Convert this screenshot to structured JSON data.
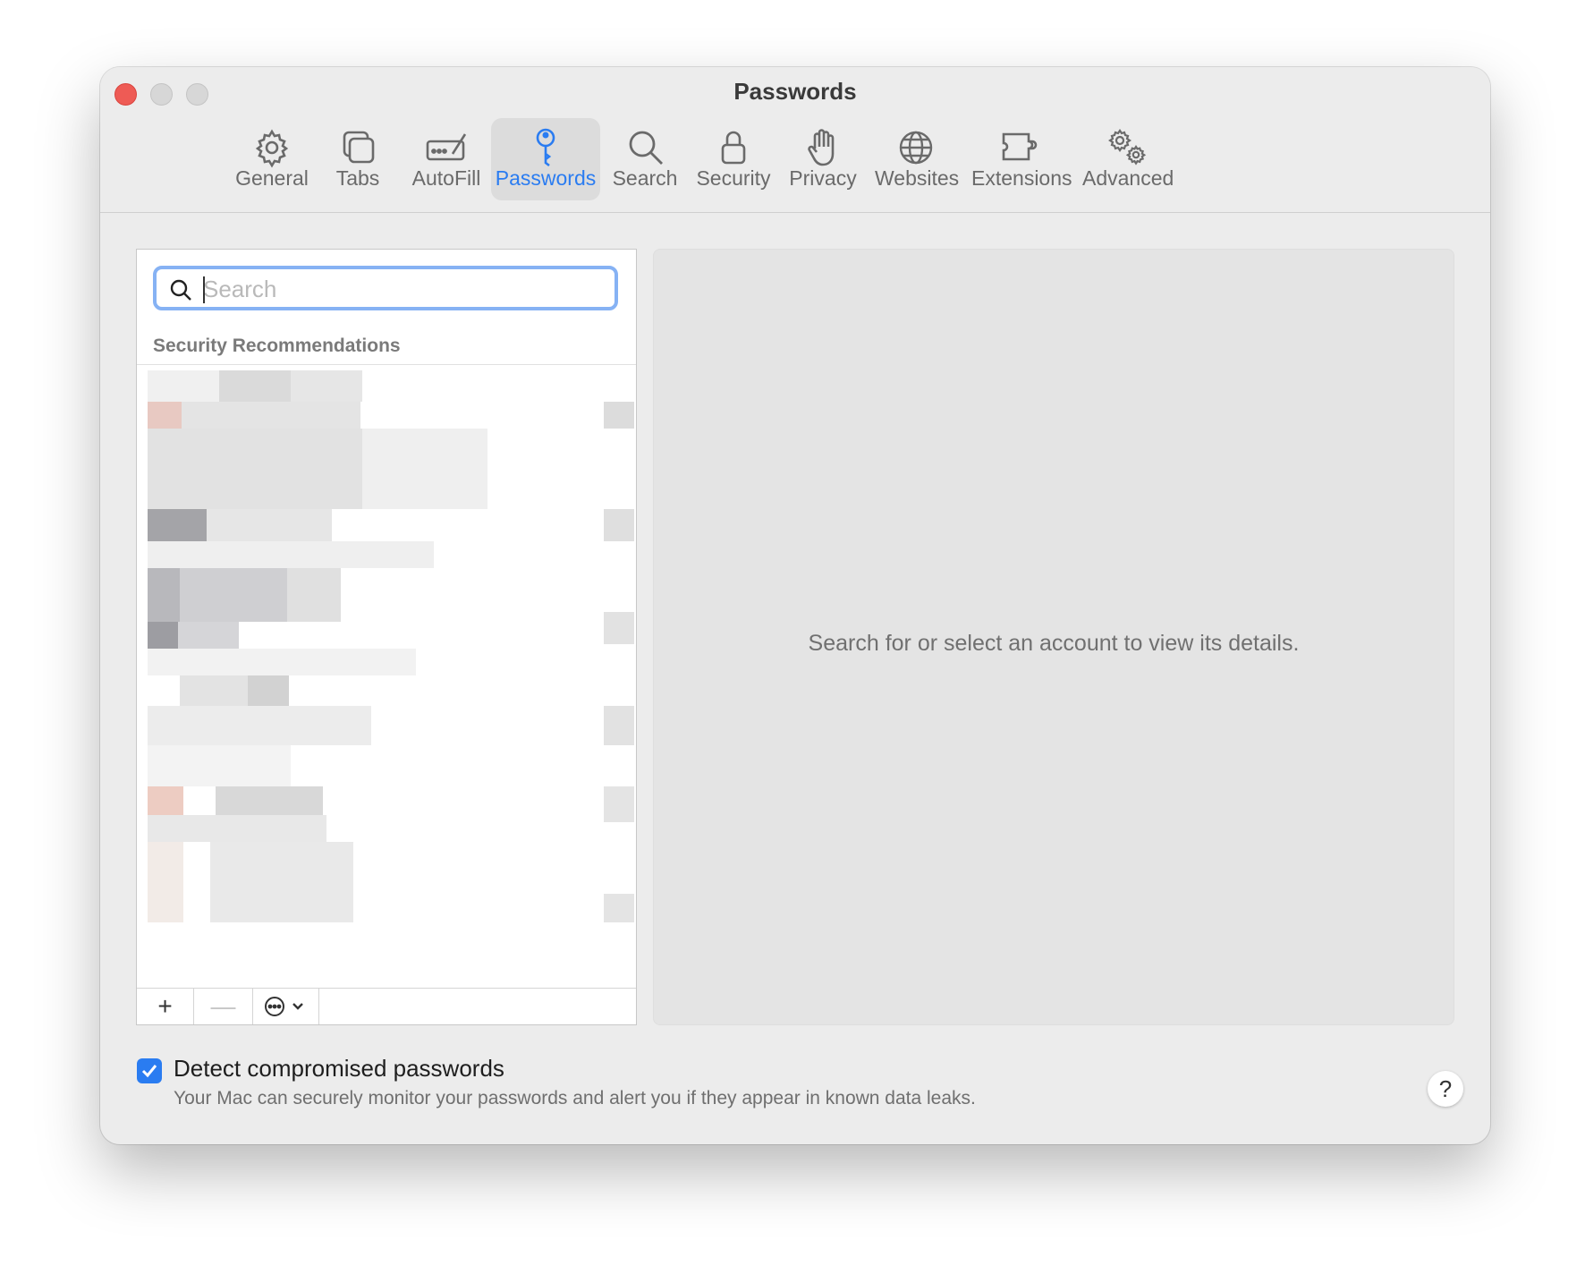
{
  "window": {
    "title": "Passwords"
  },
  "toolbar": {
    "items": [
      {
        "label": "General",
        "icon": "gear-icon",
        "active": false
      },
      {
        "label": "Tabs",
        "icon": "tabs-icon",
        "active": false
      },
      {
        "label": "AutoFill",
        "icon": "autofill-icon",
        "active": false
      },
      {
        "label": "Passwords",
        "icon": "key-icon",
        "active": true
      },
      {
        "label": "Search",
        "icon": "magnifier-icon",
        "active": false
      },
      {
        "label": "Security",
        "icon": "lock-icon",
        "active": false
      },
      {
        "label": "Privacy",
        "icon": "hand-icon",
        "active": false
      },
      {
        "label": "Websites",
        "icon": "globe-icon",
        "active": false
      },
      {
        "label": "Extensions",
        "icon": "puzzle-icon",
        "active": false
      },
      {
        "label": "Advanced",
        "icon": "gears-icon",
        "active": false
      }
    ],
    "accent_color": "#2a7cf1"
  },
  "sidebar": {
    "search": {
      "placeholder": "Search",
      "value": ""
    },
    "section_header": "Security Recommendations",
    "footer": {
      "add_label": "+",
      "remove_label": "—"
    }
  },
  "detail": {
    "empty_message": "Search for or select an account to view its details."
  },
  "options": {
    "detect_compromised": {
      "checked": true,
      "label": "Detect compromised passwords",
      "description": "Your Mac can securely monitor your passwords and alert you if they appear in known data leaks."
    },
    "help_label": "?"
  }
}
